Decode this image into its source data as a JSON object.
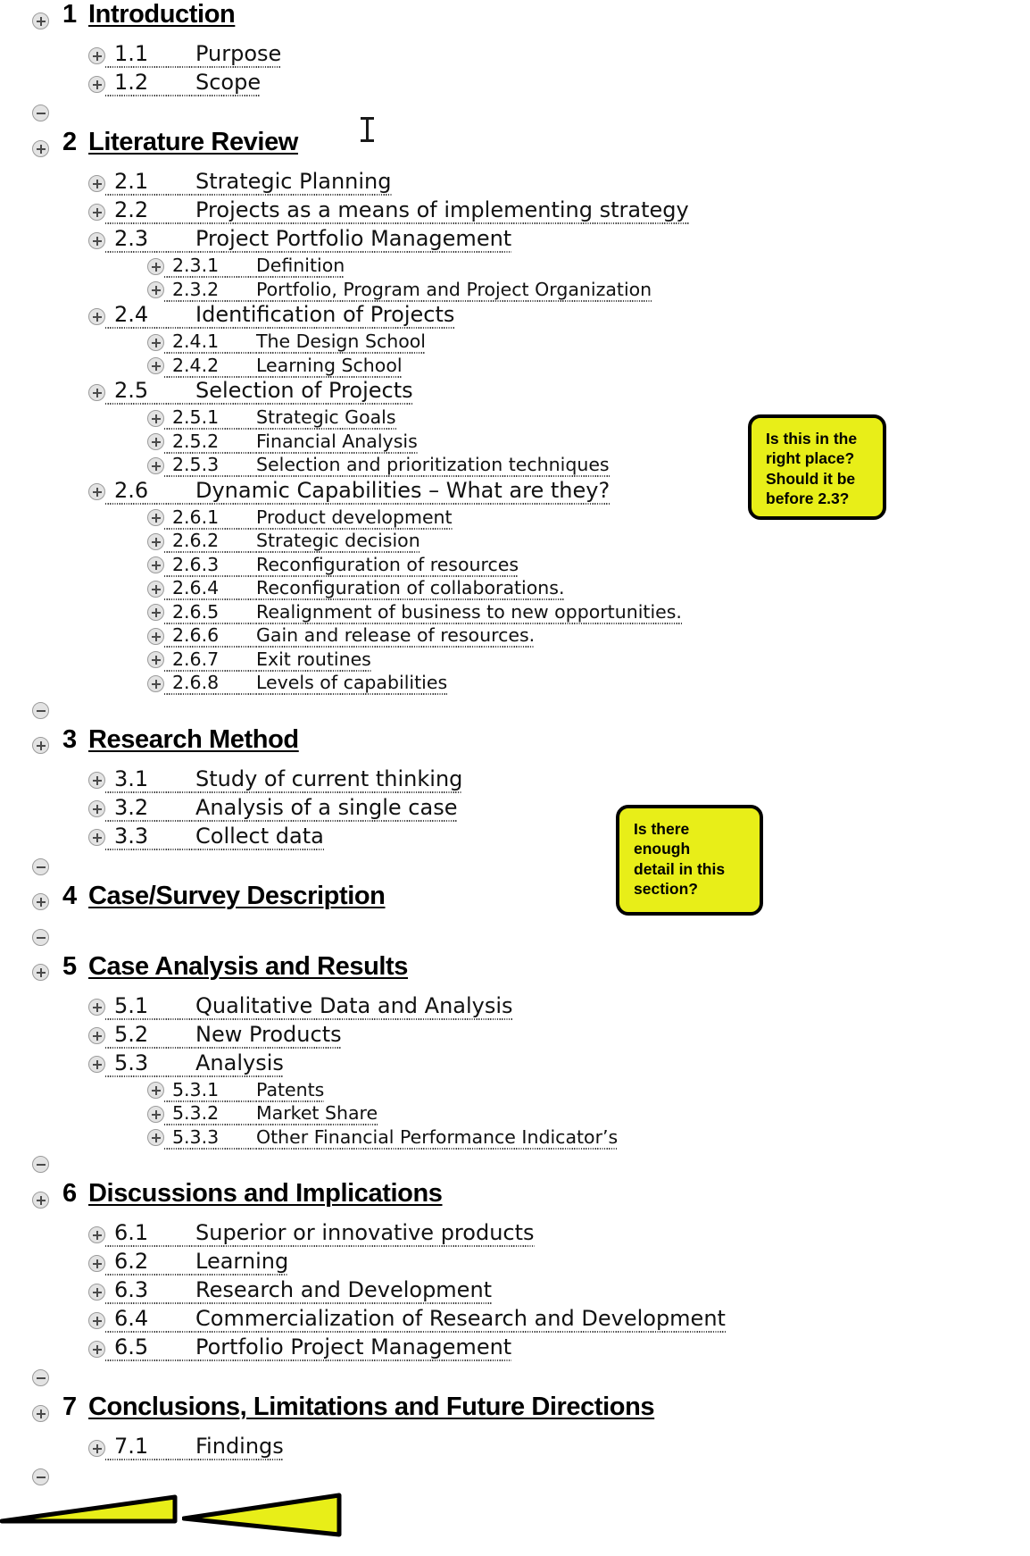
{
  "document": {
    "view": "outline",
    "accent_callout_fill": "#e8ee18",
    "callout_border": "#000000",
    "control_fill": "#e3e3e3"
  },
  "outline": [
    {
      "kind": "heading1",
      "control": "expand",
      "num": "1",
      "title": "Introduction"
    },
    {
      "kind": "heading2",
      "control": "expand",
      "num": "1.1",
      "title": "Purpose"
    },
    {
      "kind": "heading2",
      "control": "expand",
      "num": "1.2",
      "title": "Scope"
    },
    {
      "kind": "separator",
      "control": "collapse"
    },
    {
      "kind": "heading1",
      "control": "expand",
      "num": "2",
      "title": "Literature Review"
    },
    {
      "kind": "heading2",
      "control": "expand",
      "num": "2.1",
      "title": "Strategic Planning"
    },
    {
      "kind": "heading2",
      "control": "expand",
      "num": "2.2",
      "title": "Projects as a means of implementing strategy"
    },
    {
      "kind": "heading2",
      "control": "expand",
      "num": "2.3",
      "title": "Project Portfolio Management"
    },
    {
      "kind": "heading3",
      "control": "expand",
      "num": "2.3.1",
      "title": "Definition"
    },
    {
      "kind": "heading3",
      "control": "expand",
      "num": "2.3.2",
      "title": "Portfolio, Program and Project Organization"
    },
    {
      "kind": "heading2",
      "control": "expand",
      "num": "2.4",
      "title": "Identification of Projects"
    },
    {
      "kind": "heading3",
      "control": "expand",
      "num": "2.4.1",
      "title": "The Design School"
    },
    {
      "kind": "heading3",
      "control": "expand",
      "num": "2.4.2",
      "title": "Learning School"
    },
    {
      "kind": "heading2",
      "control": "expand",
      "num": "2.5",
      "title": "Selection of Projects"
    },
    {
      "kind": "heading3",
      "control": "expand",
      "num": "2.5.1",
      "title": "Strategic Goals"
    },
    {
      "kind": "heading3",
      "control": "expand",
      "num": "2.5.2",
      "title": "Financial Analysis"
    },
    {
      "kind": "heading3",
      "control": "expand",
      "num": "2.5.3",
      "title": "Selection and prioritization techniques"
    },
    {
      "kind": "heading2",
      "control": "expand",
      "num": "2.6",
      "title": "Dynamic Capabilities – What are they?"
    },
    {
      "kind": "heading3",
      "control": "expand",
      "num": "2.6.1",
      "title": "Product development"
    },
    {
      "kind": "heading3",
      "control": "expand",
      "num": "2.6.2",
      "title": "Strategic decision"
    },
    {
      "kind": "heading3",
      "control": "expand",
      "num": "2.6.3",
      "title": "Reconfiguration of resources"
    },
    {
      "kind": "heading3",
      "control": "expand",
      "num": "2.6.4",
      "title": "Reconfiguration of collaborations."
    },
    {
      "kind": "heading3",
      "control": "expand",
      "num": "2.6.5",
      "title": "Realignment of business to new opportunities."
    },
    {
      "kind": "heading3",
      "control": "expand",
      "num": "2.6.6",
      "title": "Gain and release of resources."
    },
    {
      "kind": "heading3",
      "control": "expand",
      "num": "2.6.7",
      "title": "Exit routines"
    },
    {
      "kind": "heading3",
      "control": "expand",
      "num": "2.6.8",
      "title": "Levels of capabilities"
    },
    {
      "kind": "separator",
      "control": "collapse"
    },
    {
      "kind": "heading1",
      "control": "expand",
      "num": "3",
      "title": "Research Method"
    },
    {
      "kind": "heading2",
      "control": "expand",
      "num": "3.1",
      "title": "Study of current thinking"
    },
    {
      "kind": "heading2",
      "control": "expand",
      "num": "3.2",
      "title": "Analysis of a single case"
    },
    {
      "kind": "heading2",
      "control": "expand",
      "num": "3.3",
      "title": "Collect data"
    },
    {
      "kind": "separator",
      "control": "collapse"
    },
    {
      "kind": "heading1",
      "control": "expand",
      "num": "4",
      "title": "Case/Survey Description"
    },
    {
      "kind": "separator",
      "control": "collapse"
    },
    {
      "kind": "heading1",
      "control": "expand",
      "num": "5",
      "title": "Case Analysis and Results"
    },
    {
      "kind": "heading2",
      "control": "expand",
      "num": "5.1",
      "title": "Qualitative Data and Analysis"
    },
    {
      "kind": "heading2",
      "control": "expand",
      "num": "5.2",
      "title": "New Products"
    },
    {
      "kind": "heading2",
      "control": "expand",
      "num": "5.3",
      "title": "Analysis"
    },
    {
      "kind": "heading3",
      "control": "expand",
      "num": "5.3.1",
      "title": "Patents"
    },
    {
      "kind": "heading3",
      "control": "expand",
      "num": "5.3.2",
      "title": "Market Share"
    },
    {
      "kind": "heading3",
      "control": "expand",
      "num": "5.3.3",
      "title": "Other Financial Performance Indicator’s"
    },
    {
      "kind": "separator",
      "control": "collapse"
    },
    {
      "kind": "heading1",
      "control": "expand",
      "num": "6",
      "title": "Discussions and Implications"
    },
    {
      "kind": "heading2",
      "control": "expand",
      "num": "6.1",
      "title": "Superior or innovative products"
    },
    {
      "kind": "heading2",
      "control": "expand",
      "num": "6.2",
      "title": "Learning"
    },
    {
      "kind": "heading2",
      "control": "expand",
      "num": "6.3",
      "title": "Research and Development"
    },
    {
      "kind": "heading2",
      "control": "expand",
      "num": "6.4",
      "title": "Commercialization of Research and Development"
    },
    {
      "kind": "heading2",
      "control": "expand",
      "num": "6.5",
      "title": "Portfolio Project Management"
    },
    {
      "kind": "separator",
      "control": "collapse"
    },
    {
      "kind": "heading1",
      "control": "expand",
      "num": "7",
      "title": "Conclusions, Limitations and Future Directions"
    },
    {
      "kind": "heading2",
      "control": "expand",
      "num": "7.1",
      "title": "Findings"
    },
    {
      "kind": "separator",
      "control": "collapse"
    }
  ],
  "callouts": [
    {
      "id": "callout-section-2-6",
      "lines": [
        "Is this in the",
        "right place?",
        "Should it be",
        "before 2.3?"
      ],
      "text": "Is this in the right place? Should it be before 2.3?"
    },
    {
      "id": "callout-section-4",
      "lines": [
        "Is there",
        "enough",
        "detail in this",
        "section?"
      ],
      "text": "Is there enough detail in this section?"
    }
  ]
}
